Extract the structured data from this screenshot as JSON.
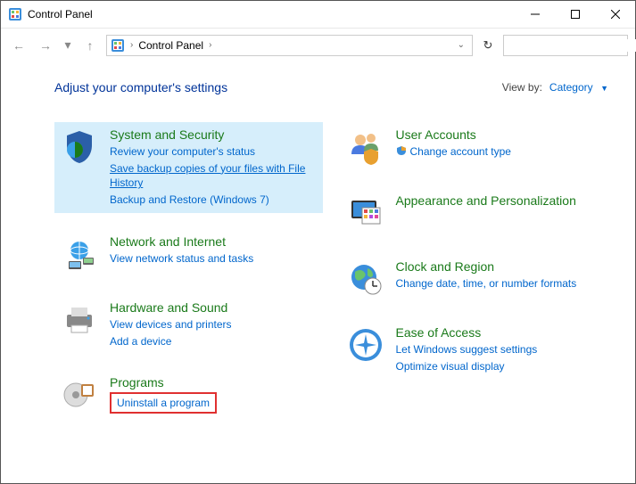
{
  "window": {
    "title": "Control Panel"
  },
  "nav": {
    "breadcrumb": "Control Panel"
  },
  "search": {
    "placeholder": ""
  },
  "heading": "Adjust your computer's settings",
  "viewby": {
    "label": "View by:",
    "value": "Category"
  },
  "cats": {
    "system": {
      "title": "System and Security",
      "links": [
        "Review your computer's status",
        "Save backup copies of your files with File History",
        "Backup and Restore (Windows 7)"
      ]
    },
    "network": {
      "title": "Network and Internet",
      "links": [
        "View network status and tasks"
      ]
    },
    "hardware": {
      "title": "Hardware and Sound",
      "links": [
        "View devices and printers",
        "Add a device"
      ]
    },
    "programs": {
      "title": "Programs",
      "links": [
        "Uninstall a program"
      ]
    },
    "users": {
      "title": "User Accounts",
      "links": [
        "Change account type"
      ]
    },
    "appearance": {
      "title": "Appearance and Personalization",
      "links": []
    },
    "clock": {
      "title": "Clock and Region",
      "links": [
        "Change date, time, or number formats"
      ]
    },
    "ease": {
      "title": "Ease of Access",
      "links": [
        "Let Windows suggest settings",
        "Optimize visual display"
      ]
    }
  }
}
